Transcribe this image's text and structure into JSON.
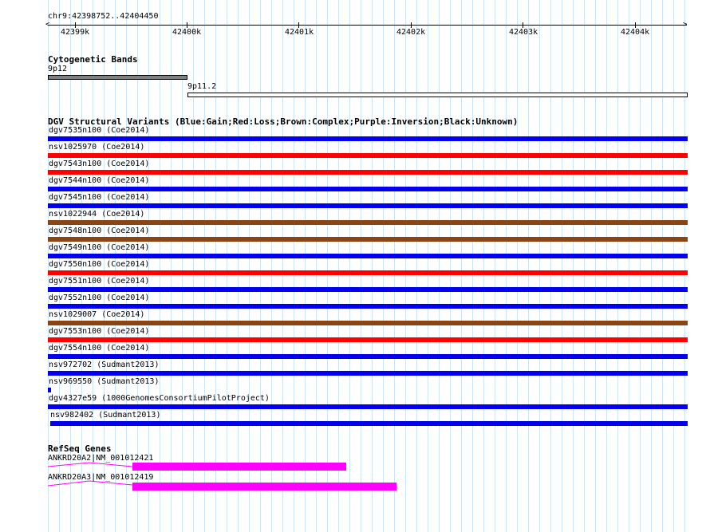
{
  "ruler": {
    "position": "chr9:42398752..42404450",
    "ticks": [
      "42399k",
      "42400k",
      "42401k",
      "42402k",
      "42403k",
      "42404k"
    ]
  },
  "cytobands": {
    "title": "Cytogenetic Bands",
    "bands": [
      {
        "name": "9p12",
        "color": "#808080"
      },
      {
        "name": "9p11.2",
        "color": "#ffffff"
      }
    ]
  },
  "dgv": {
    "title": "DGV Structural Variants (Blue:Gain;Red:Loss;Brown:Complex;Purple:Inversion;Black:Unknown)",
    "colors": {
      "gain": "#0000ee",
      "loss": "#ff0000",
      "complex": "#8b4513"
    },
    "variants": [
      {
        "label": "dgv7535n100 (Coe2014)",
        "type": "gain"
      },
      {
        "label": "nsv1025970 (Coe2014)",
        "type": "loss"
      },
      {
        "label": "dgv7543n100 (Coe2014)",
        "type": "loss"
      },
      {
        "label": "dgv7544n100 (Coe2014)",
        "type": "gain"
      },
      {
        "label": "dgv7545n100 (Coe2014)",
        "type": "gain"
      },
      {
        "label": "nsv1022944 (Coe2014)",
        "type": "complex"
      },
      {
        "label": "dgv7548n100 (Coe2014)",
        "type": "complex"
      },
      {
        "label": "dgv7549n100 (Coe2014)",
        "type": "gain"
      },
      {
        "label": "dgv7550n100 (Coe2014)",
        "type": "loss"
      },
      {
        "label": "dgv7551n100 (Coe2014)",
        "type": "gain"
      },
      {
        "label": "dgv7552n100 (Coe2014)",
        "type": "gain"
      },
      {
        "label": "nsv1029007 (Coe2014)",
        "type": "complex"
      },
      {
        "label": "dgv7553n100 (Coe2014)",
        "type": "loss"
      },
      {
        "label": "dgv7554n100 (Coe2014)",
        "type": "gain"
      },
      {
        "label": "nsv972702 (Sudmant2013)",
        "type": "gain"
      },
      {
        "label": "nsv969550 (Sudmant2013)",
        "type": "gain"
      },
      {
        "label": "dgv4327e59 (1000GenomesConsortiumPilotProject)",
        "type": "gain"
      },
      {
        "label": "nsv982402 (Sudmant2013)",
        "type": "gain"
      }
    ]
  },
  "refseq": {
    "title": "RefSeq Genes",
    "color": "#ff00ff",
    "genes": [
      {
        "label": "ANKRD20A2|NM_001012421"
      },
      {
        "label": "ANKRD20A3|NM_001012419"
      }
    ]
  }
}
